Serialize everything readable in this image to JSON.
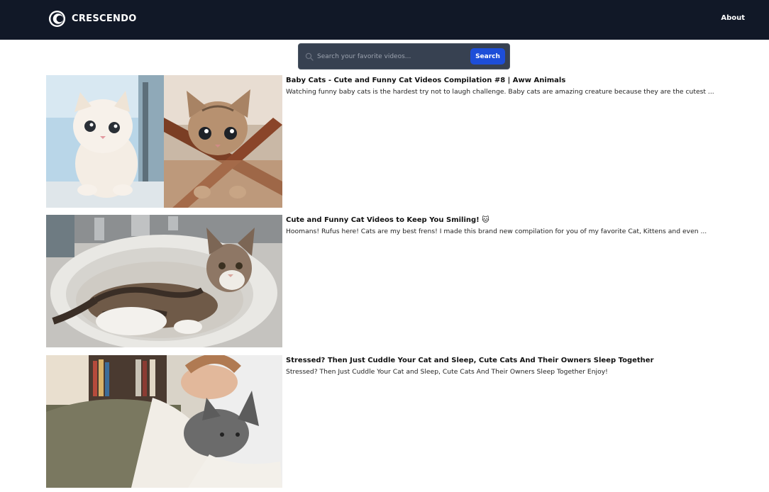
{
  "navbar": {
    "brand_name": "CRESCENDO",
    "about_label": "About"
  },
  "search": {
    "placeholder": "Search your favorite videos...",
    "value": "",
    "button_label": "Search"
  },
  "results": [
    {
      "title": "Baby Cats - Cute and Funny Cat Videos Compilation #8 | Aww Animals",
      "description": "Watching funny baby cats is the hardest try not to laugh challenge. Baby cats are amazing creature because they are the cutest ..."
    },
    {
      "title": "Cute and Funny Cat Videos to Keep You Smiling! 🐱",
      "description": "Hoomans! Rufus here! Cats are my best frens! I made this brand new compilation for you of my favorite Cat, Kittens and even ..."
    },
    {
      "title": "Stressed? Then Just Cuddle Your Cat and Sleep, Cute Cats And Their Owners Sleep Together",
      "description": "Stressed? Then Just Cuddle Your Cat and Sleep, Cute Cats And Their Owners Sleep Together Enjoy!"
    }
  ],
  "colors": {
    "navbar_bg": "#111827",
    "search_bg": "#374151",
    "search_button": "#1d4ed8"
  }
}
